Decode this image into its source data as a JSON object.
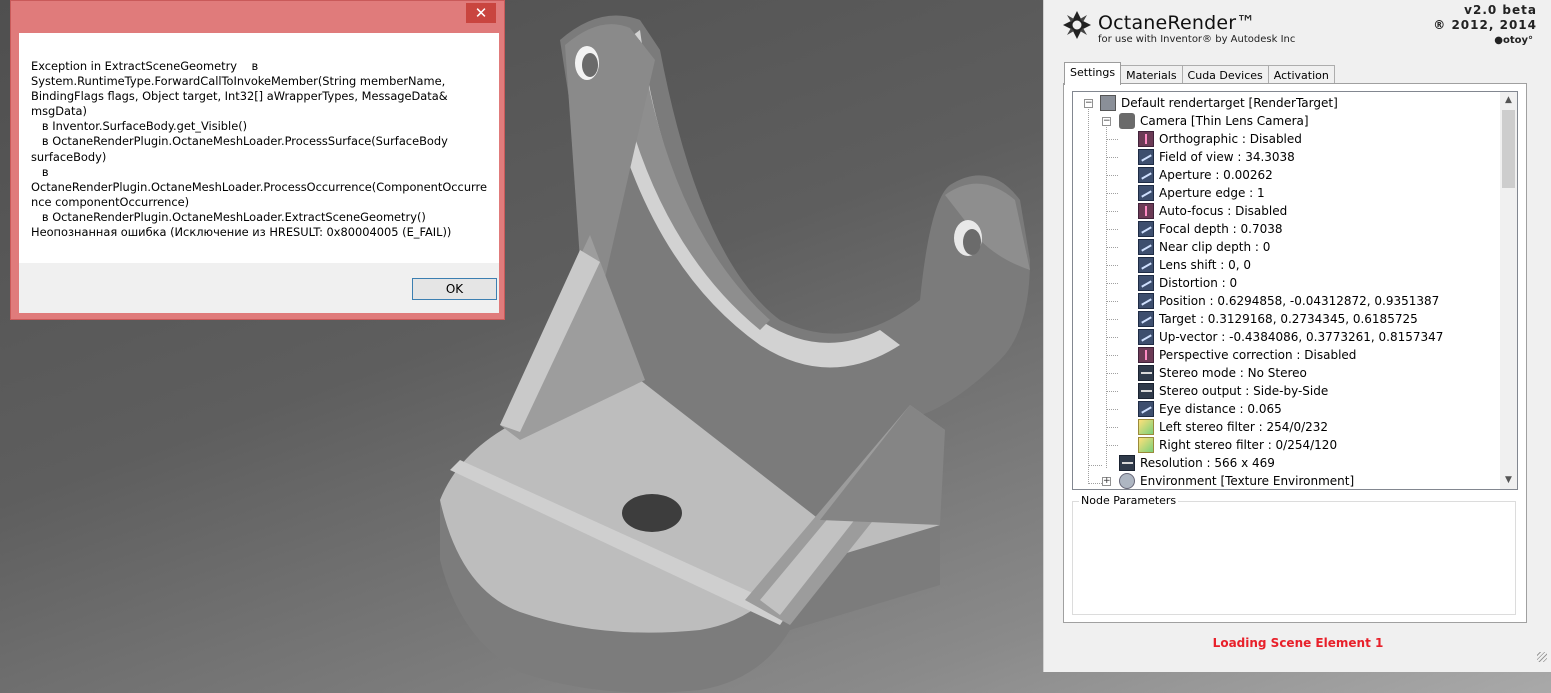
{
  "dialog": {
    "close_glyph": "✕",
    "message": "Exception in ExtractSceneGeometry    в\nSystem.RuntimeType.ForwardCallToInvokeMember(String memberName,\nBindingFlags flags, Object target, Int32[] aWrapperTypes, MessageData&\nmsgData)\n   в Inventor.SurfaceBody.get_Visible()\n   в OctaneRenderPlugin.OctaneMeshLoader.ProcessSurface(SurfaceBody\nsurfaceBody)\n   в\nOctaneRenderPlugin.OctaneMeshLoader.ProcessOccurrence(ComponentOccurre\nnce componentOccurrence)\n   в OctaneRenderPlugin.OctaneMeshLoader.ExtractSceneGeometry()\nНеопознанная ошибка (Исключение из HRESULT: 0x80004005 (E_FAIL))",
    "ok_label": "OK"
  },
  "panel": {
    "title": "OctaneRender™",
    "subtitle": "for use with Inventor® by Autodesk Inc",
    "version": "v2.0 beta",
    "copyright": "® 2012, 2014",
    "otoy": "●otoy°",
    "tabs": [
      "Settings",
      "Materials",
      "Cuda Devices",
      "Activation"
    ],
    "active_tab": "Settings",
    "tree": {
      "root": "Default rendertarget  [RenderTarget]",
      "camera": "Camera  [Thin Lens Camera]",
      "camera_items": [
        {
          "label": "Orthographic : Disabled",
          "icon": "bool-icon"
        },
        {
          "label": "Field of view : 34.3038",
          "icon": "float-icon"
        },
        {
          "label": "Aperture : 0.00262",
          "icon": "float-icon"
        },
        {
          "label": "Aperture edge : 1",
          "icon": "float-icon"
        },
        {
          "label": "Auto-focus : Disabled",
          "icon": "bool-icon"
        },
        {
          "label": "Focal depth : 0.7038",
          "icon": "float-icon"
        },
        {
          "label": "Near clip depth : 0",
          "icon": "float-icon"
        },
        {
          "label": "Lens shift : 0, 0",
          "icon": "float-icon"
        },
        {
          "label": "Distortion : 0",
          "icon": "float-icon"
        },
        {
          "label": "Position : 0.6294858, -0.04312872, 0.9351387",
          "icon": "float-icon"
        },
        {
          "label": "Target : 0.3129168, 0.2734345, 0.6185725",
          "icon": "float-icon"
        },
        {
          "label": "Up-vector : -0.4384086, 0.3773261, 0.8157347",
          "icon": "float-icon"
        },
        {
          "label": "Perspective correction : Disabled",
          "icon": "bool-icon"
        },
        {
          "label": "Stereo mode : No Stereo",
          "icon": "enum-icon"
        },
        {
          "label": "Stereo output : Side-by-Side",
          "icon": "enum-icon"
        },
        {
          "label": "Eye distance : 0.065",
          "icon": "float-icon"
        },
        {
          "label": "Left stereo filter : 254/0/232",
          "icon": "filter-icon"
        },
        {
          "label": "Right stereo filter : 0/254/120",
          "icon": "filter-icon"
        }
      ],
      "resolution": "Resolution : 566 x 469",
      "environment": "Environment  [Texture Environment]"
    },
    "node_parameters_title": "Node Parameters",
    "status": "Loading Scene Element 1",
    "colors": {
      "status": "#e8202a",
      "dialog_frame": "#e07b7b"
    }
  }
}
